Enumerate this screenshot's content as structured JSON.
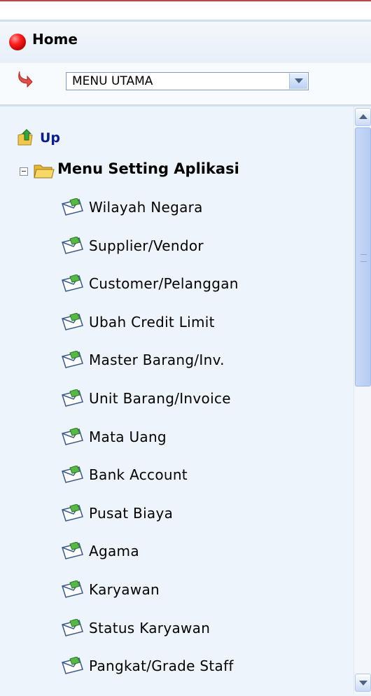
{
  "header": {
    "home_label": "Home"
  },
  "menu_select": {
    "selected": "MENU UTAMA"
  },
  "tree": {
    "up_label": "Up",
    "folder_label": "Menu Setting Aplikasi",
    "items": [
      "Wilayah Negara",
      "Supplier/Vendor",
      "Customer/Pelanggan",
      "Ubah Credit Limit",
      "Master Barang/Inv.",
      "Unit Barang/Invoice",
      "Mata Uang",
      "Bank Account",
      "Pusat Biaya",
      "Agama",
      "Karyawan",
      "Status Karyawan",
      "Pangkat/Grade Staff"
    ]
  },
  "colors": {
    "accent_red": "#ff2020",
    "up_link": "#0b1e8a",
    "panel_bg": "#eef4fb"
  }
}
